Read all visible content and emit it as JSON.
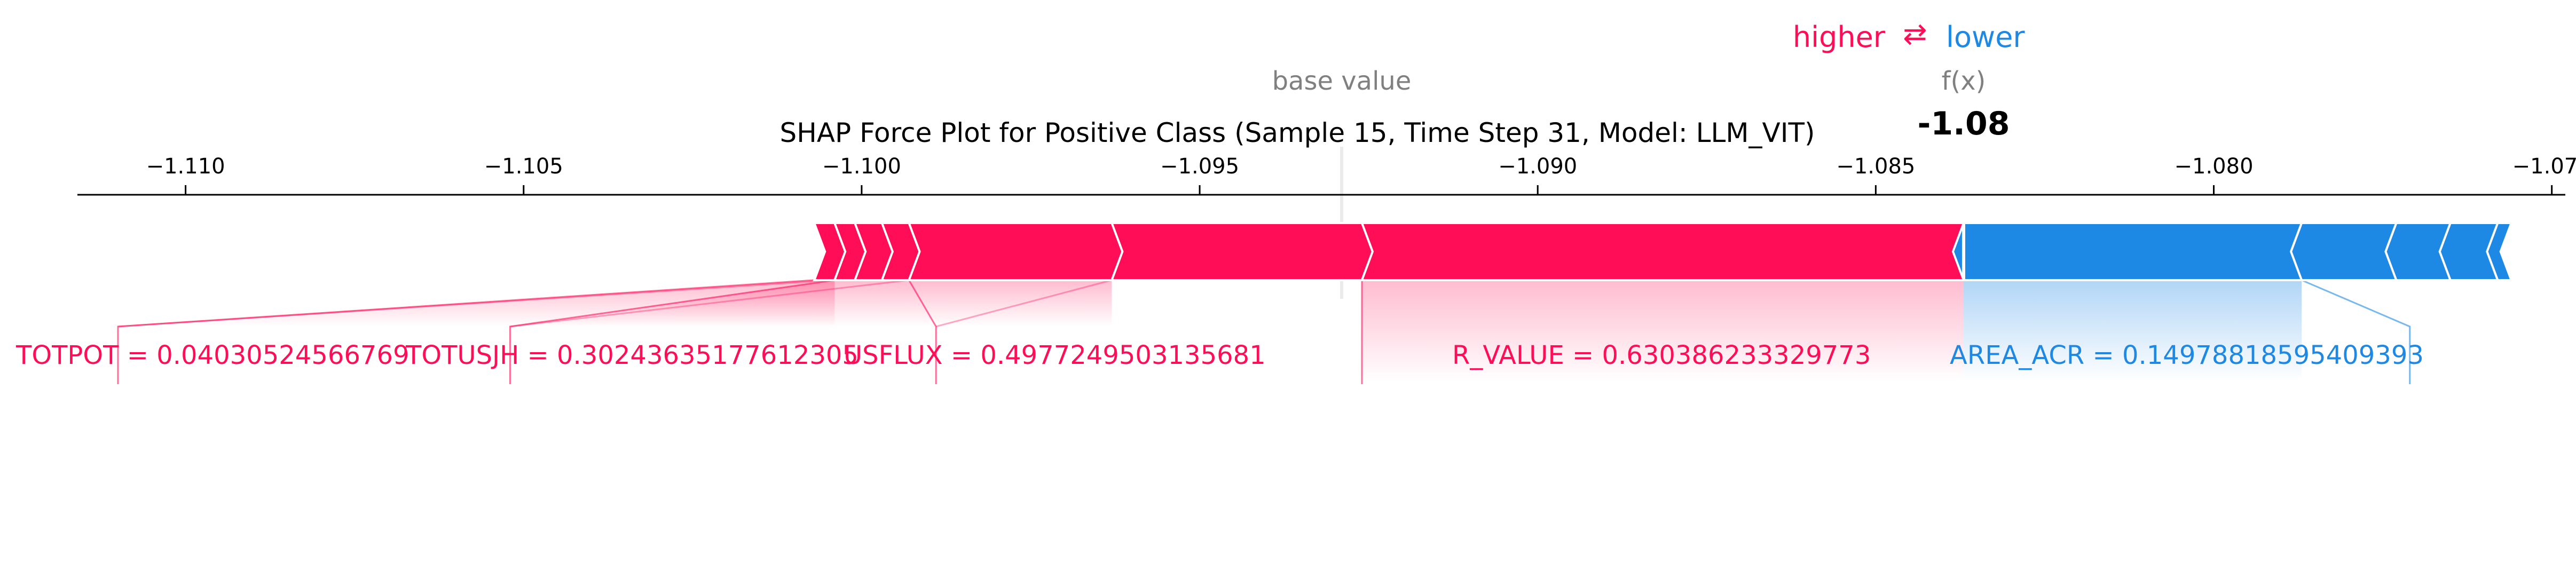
{
  "chart_data": {
    "type": "shap-force",
    "title": "SHAP Force Plot for Positive Class (Sample 15, Time Step 31, Model: LLM_VIT)",
    "xlim": [
      -1.1116,
      -1.0748
    ],
    "ticks": [
      {
        "value": -1.11,
        "label": "−1.110"
      },
      {
        "value": -1.105,
        "label": "−1.105"
      },
      {
        "value": -1.1,
        "label": "−1.100"
      },
      {
        "value": -1.095,
        "label": "−1.095"
      },
      {
        "value": -1.09,
        "label": "−1.090"
      },
      {
        "value": -1.085,
        "label": "−1.085"
      },
      {
        "value": -1.08,
        "label": "−1.080"
      },
      {
        "value": -1.075,
        "label": "−1.075"
      }
    ],
    "base_value": -1.0929,
    "base_value_label": "base value",
    "fx": -1.0837,
    "fx_label": "f(x)",
    "fx_text": "-1.08",
    "legend": {
      "higher": "higher",
      "arrow": "⇄",
      "lower": "lower"
    },
    "colors": {
      "positive": "#ff0d57",
      "negative": "#1e88e5",
      "grey": "#808080"
    },
    "positive_segments": [
      {
        "start": -1.1007,
        "end": -1.1004
      },
      {
        "start": -1.1004,
        "end": -1.1001
      },
      {
        "start": -1.1001,
        "end": -1.0997
      },
      {
        "start": -1.0997,
        "end": -1.0993
      },
      {
        "start": -1.0993,
        "end": -1.0963
      },
      {
        "start": -1.0963,
        "end": -1.0926
      },
      {
        "start": -1.0926,
        "end": -1.0837
      }
    ],
    "negative_segments": [
      {
        "start": -1.0837,
        "end": -1.0787
      },
      {
        "start": -1.0787,
        "end": -1.0773
      },
      {
        "start": -1.0773,
        "end": -1.0765
      },
      {
        "start": -1.0765,
        "end": -1.0758
      },
      {
        "start": -1.0758,
        "end": -1.0756
      }
    ],
    "feature_labels": [
      {
        "text": "TOTPOT = 0.04030524566769",
        "color": "positive",
        "bar_from": -1.1007,
        "bar_to": -1.1004,
        "anchor": -1.111
      },
      {
        "text": "TOTUSJH = 0.30243635177612305",
        "color": "positive",
        "bar_from": -1.1004,
        "bar_to": -1.0993,
        "anchor": -1.1052
      },
      {
        "text": "USFLUX = 0.4977249503135681",
        "color": "positive",
        "bar_from": -1.0993,
        "bar_to": -1.0963,
        "anchor": -1.0989
      },
      {
        "text": "R_VALUE = 0.630386233329773",
        "color": "positive",
        "bar_from": -1.0926,
        "bar_to": -1.0926,
        "anchor": -1.0926
      },
      {
        "text": "AREA_ACR = 0.14978818595409393",
        "color": "negative",
        "bar_from": -1.0787,
        "bar_to": -1.0787,
        "anchor": -1.0771
      }
    ]
  }
}
